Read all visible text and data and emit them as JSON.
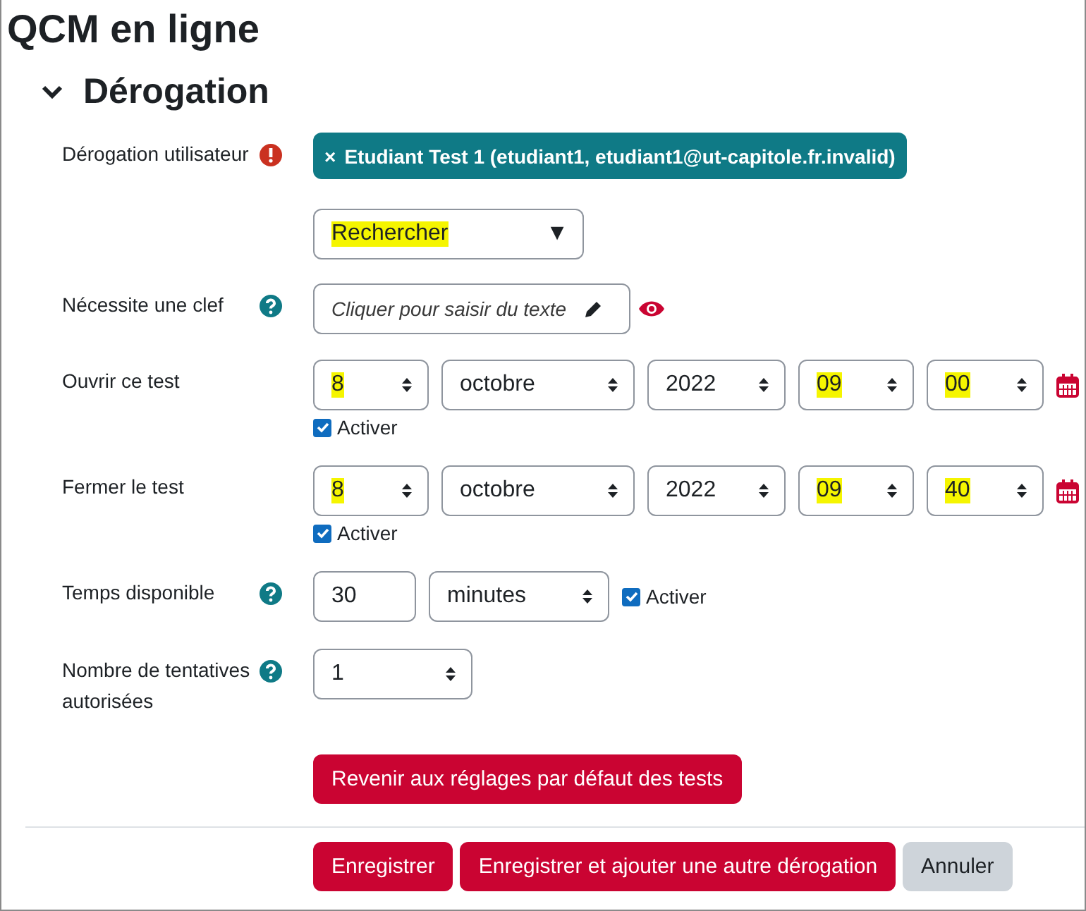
{
  "title": "QCM en ligne",
  "section": {
    "title": "Dérogation",
    "expanded": true
  },
  "fields": [
    {
      "kind": "user",
      "label": "Dérogation utilisateur",
      "tags": [
        {
          "close": "×",
          "text": "Etudiant Test 1 (etudiant1, etudiant1@ut-capitole.fr.invalid)"
        }
      ],
      "search": {
        "value": "Rechercher",
        "highlighted": true,
        "arrow": "▼"
      }
    },
    {
      "kind": "password",
      "label": "Nécessite une clef",
      "placeholder": "Cliquer pour saisir du texte"
    },
    {
      "kind": "datetime",
      "label": "Ouvrir ce test",
      "selects": [
        {
          "value": "8",
          "highlighted": true
        },
        {
          "value": "octobre",
          "highlighted": false
        },
        {
          "value": "2022",
          "highlighted": false
        },
        {
          "value": "09",
          "highlighted": true
        },
        {
          "value": "00",
          "highlighted": true
        }
      ],
      "enable": {
        "label": "Activer",
        "checked": true
      }
    },
    {
      "kind": "datetime",
      "label": "Fermer le test",
      "selects": [
        {
          "value": "8",
          "highlighted": true
        },
        {
          "value": "octobre",
          "highlighted": false
        },
        {
          "value": "2022",
          "highlighted": false
        },
        {
          "value": "09",
          "highlighted": true
        },
        {
          "value": "40",
          "highlighted": true
        }
      ],
      "enable": {
        "label": "Activer",
        "checked": true
      }
    },
    {
      "kind": "duration",
      "label": "Temps disponible",
      "value": "30",
      "unit": "minutes",
      "enable": {
        "label": "Activer",
        "checked": true
      }
    },
    {
      "kind": "select",
      "label": "Nombre de tentatives autorisées",
      "value": "1"
    }
  ],
  "reset_button": "Revenir aux réglages par défaut des tests",
  "buttons": [
    {
      "label": "Enregistrer",
      "kind": "primary"
    },
    {
      "label": "Enregistrer et ajouter une autre dérogation",
      "kind": "primary"
    },
    {
      "label": "Annuler",
      "kind": "secondary"
    }
  ]
}
